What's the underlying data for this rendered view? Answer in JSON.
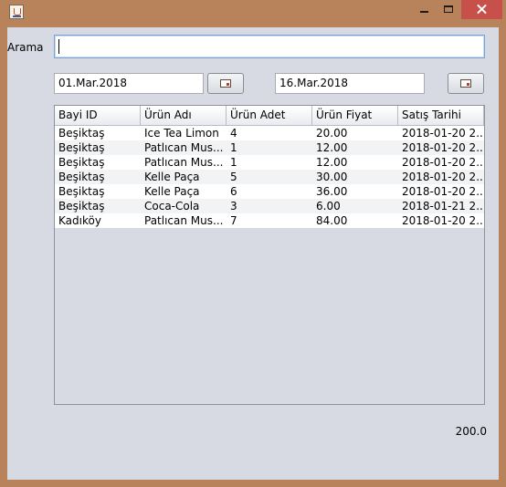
{
  "window": {
    "icon": "java-cup-icon",
    "controls": [
      "minimize-icon",
      "maximize-icon",
      "close-icon"
    ]
  },
  "search": {
    "label": "Arama",
    "value": ""
  },
  "date_range": {
    "start": "01.Mar.2018",
    "end": "16.Mar.2018",
    "picker_icon": "calendar-icon"
  },
  "table": {
    "columns": [
      "Bayi ID",
      "Ürün Adı",
      "Ürün Adet",
      "Ürün Fiyat",
      "Satış Tarihi"
    ],
    "rows": [
      [
        "Beşiktaş",
        "Ice Tea Limon",
        "4",
        "20.00",
        "2018-01-20 2..."
      ],
      [
        "Beşiktaş",
        "Patlıcan Mus...",
        "1",
        "12.00",
        "2018-01-20 2..."
      ],
      [
        "Beşiktaş",
        "Patlıcan Mus...",
        "1",
        "12.00",
        "2018-01-20 2..."
      ],
      [
        "Beşiktaş",
        "Kelle Paça",
        "5",
        "30.00",
        "2018-01-20 2..."
      ],
      [
        "Beşiktaş",
        "Kelle Paça",
        "6",
        "36.00",
        "2018-01-20 2..."
      ],
      [
        "Beşiktaş",
        "Coca-Cola",
        "3",
        "6.00",
        "2018-01-21 2..."
      ],
      [
        "Kadıköy",
        "Patlıcan Mus...",
        "7",
        "84.00",
        "2018-01-20 2..."
      ]
    ]
  },
  "total": "200.0",
  "colors": {
    "window_frame": "#b8825a",
    "client_bg": "#d7dae2",
    "close_button": "#c7504a"
  }
}
